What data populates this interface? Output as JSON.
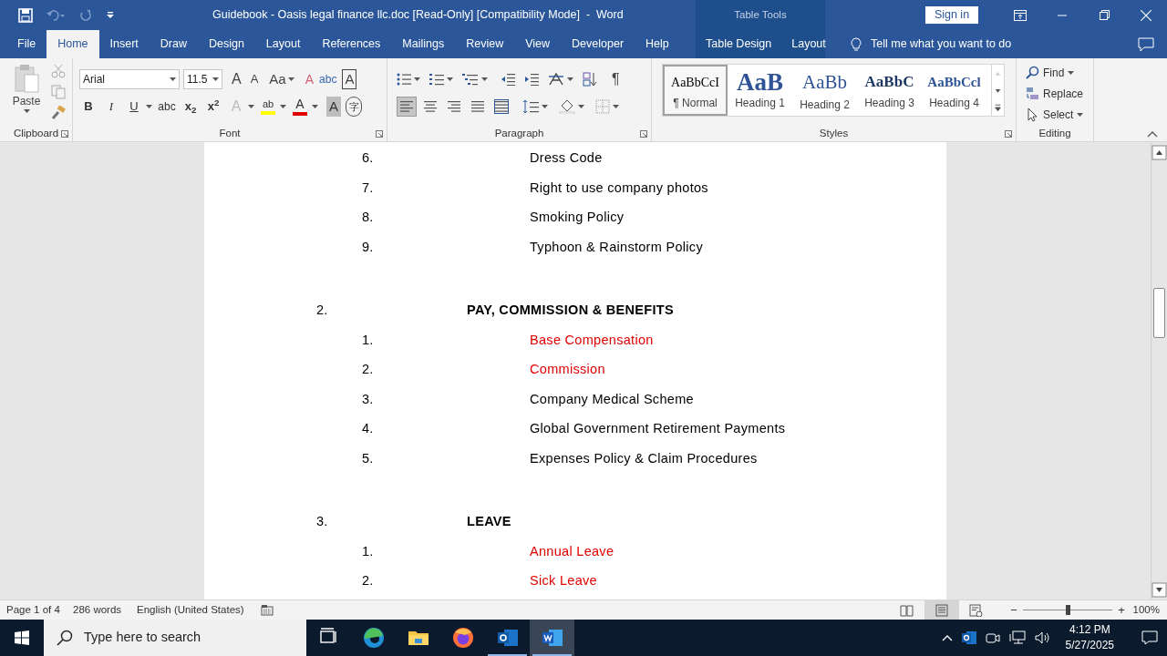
{
  "title_bar": {
    "title": "Guidebook - Oasis legal finance llc.doc [Read-Only] [Compatibility Mode]  -  Word",
    "context_label": "Table Tools",
    "sign_in": "Sign in"
  },
  "tabs": [
    {
      "label": "File",
      "selected": false,
      "kind": "main"
    },
    {
      "label": "Home",
      "selected": true,
      "kind": "main"
    },
    {
      "label": "Insert",
      "selected": false,
      "kind": "main"
    },
    {
      "label": "Draw",
      "selected": false,
      "kind": "main"
    },
    {
      "label": "Design",
      "selected": false,
      "kind": "main"
    },
    {
      "label": "Layout",
      "selected": false,
      "kind": "main"
    },
    {
      "label": "References",
      "selected": false,
      "kind": "main"
    },
    {
      "label": "Mailings",
      "selected": false,
      "kind": "main"
    },
    {
      "label": "Review",
      "selected": false,
      "kind": "main"
    },
    {
      "label": "View",
      "selected": false,
      "kind": "main"
    },
    {
      "label": "Developer",
      "selected": false,
      "kind": "main"
    },
    {
      "label": "Help",
      "selected": false,
      "kind": "main"
    },
    {
      "label": "Table Design",
      "selected": false,
      "kind": "context"
    },
    {
      "label": "Layout",
      "selected": false,
      "kind": "context"
    }
  ],
  "tell_me": {
    "placeholder": "Tell me what you want to do"
  },
  "ribbon": {
    "clipboard": {
      "label": "Clipboard",
      "paste": "Paste"
    },
    "font": {
      "label": "Font",
      "font_name": "Arial",
      "font_size": "11.5",
      "row1": [
        {
          "kind": "grow",
          "glyph": "A"
        },
        {
          "kind": "shrink",
          "glyph": "A"
        },
        {
          "kind": "case",
          "glyph": "Aa"
        },
        {
          "kind": "clear",
          "glyph": "A"
        },
        {
          "kind": "phonetic",
          "glyph": "abc"
        },
        {
          "kind": "border",
          "glyph": "A"
        }
      ],
      "row2": [
        {
          "kind": "bold",
          "glyph": "B"
        },
        {
          "kind": "italic",
          "glyph": "I"
        },
        {
          "kind": "underline",
          "glyph": "U"
        },
        {
          "kind": "strike",
          "glyph": "abc"
        },
        {
          "kind": "sub",
          "glyph": "x$_{2}$"
        },
        {
          "kind": "sup",
          "glyph": "x$^{2}$"
        },
        {
          "kind": "effects",
          "glyph": "A"
        },
        {
          "kind": "highlight",
          "glyph": "ab",
          "color": "#ffff00"
        },
        {
          "kind": "fontcolor",
          "glyph": "A",
          "color": "#e00000"
        },
        {
          "kind": "shading",
          "glyph": "A"
        },
        {
          "kind": "enclose",
          "glyph": "字"
        }
      ]
    },
    "paragraph": {
      "label": "Paragraph",
      "pilcrow": "¶",
      "align": [
        {
          "kind": "left",
          "selected": true
        },
        {
          "kind": "center",
          "selected": false
        },
        {
          "kind": "right",
          "selected": false
        },
        {
          "kind": "justify",
          "selected": false
        },
        {
          "kind": "distributed",
          "selected": false
        }
      ]
    },
    "styles": {
      "label": "Styles",
      "items": [
        {
          "preview": "AaBbCcI",
          "name": "¶ Normal",
          "kind": "normal",
          "selected": true
        },
        {
          "preview": "AaB",
          "name": "Heading 1",
          "kind": "h1",
          "selected": false
        },
        {
          "preview": "AaBb",
          "name": "Heading 2",
          "kind": "h2",
          "selected": false
        },
        {
          "preview": "AaBbC",
          "name": "Heading 3",
          "kind": "h3",
          "selected": false
        },
        {
          "preview": "AaBbCcl",
          "name": "Heading 4",
          "kind": "h4",
          "selected": false
        }
      ]
    },
    "editing": {
      "label": "Editing",
      "buttons": [
        {
          "label": "Find",
          "kind": "find"
        },
        {
          "label": "Replace",
          "kind": "replace"
        },
        {
          "label": "Select",
          "kind": "select"
        }
      ]
    }
  },
  "document": {
    "blocks": [
      {
        "kind": "item",
        "number": "6.",
        "text": "Dress Code",
        "color": "#000000"
      },
      {
        "kind": "item",
        "number": "7.",
        "text": "Right to use company photos",
        "color": "#000000"
      },
      {
        "kind": "item",
        "number": "8.",
        "text": "Smoking Policy",
        "color": "#000000"
      },
      {
        "kind": "item",
        "number": "9.",
        "text": "Typhoon & Rainstorm Policy",
        "color": "#000000"
      },
      {
        "kind": "heading",
        "number": "2.",
        "text": "PAY, COMMISSION & BENEFITS",
        "color": "#000000"
      },
      {
        "kind": "item",
        "number": "1.",
        "text": "Base Compensation",
        "color": "#e00000"
      },
      {
        "kind": "item",
        "number": "2.",
        "text": "Commission",
        "color": "#e00000"
      },
      {
        "kind": "item",
        "number": "3.",
        "text": "Company Medical Scheme",
        "color": "#000000"
      },
      {
        "kind": "item",
        "number": "4.",
        "text": "Global Government Retirement Payments",
        "color": "#000000"
      },
      {
        "kind": "item",
        "number": "5.",
        "text": "Expenses Policy & Claim Procedures",
        "color": "#000000"
      },
      {
        "kind": "heading",
        "number": "3.",
        "text": "LEAVE",
        "color": "#000000"
      },
      {
        "kind": "item",
        "number": "1.",
        "text": "Annual Leave",
        "color": "#e00000"
      },
      {
        "kind": "item",
        "number": "2.",
        "text": "Sick Leave",
        "color": "#e00000"
      }
    ]
  },
  "status_bar": {
    "page": "Page 1 of 4",
    "words": "286 words",
    "language": "English (United States)",
    "views": [
      {
        "kind": "read",
        "selected": false
      },
      {
        "kind": "print",
        "selected": true
      },
      {
        "kind": "web",
        "selected": false
      }
    ],
    "zoom": {
      "minus": "−",
      "plus": "+",
      "level": 0.5,
      "reading": "100%"
    }
  },
  "taskbar": {
    "search_placeholder": "Type here to search",
    "apps": [
      {
        "kind": "taskview",
        "running": false,
        "selected": false
      },
      {
        "kind": "edge",
        "running": false,
        "selected": false
      },
      {
        "kind": "explorer",
        "running": false,
        "selected": false
      },
      {
        "kind": "firefox",
        "running": false,
        "selected": false
      },
      {
        "kind": "outlook",
        "running": true,
        "selected": false
      },
      {
        "kind": "word",
        "running": true,
        "selected": true
      }
    ],
    "time": "4:12 PM",
    "date": "5/27/2025"
  }
}
